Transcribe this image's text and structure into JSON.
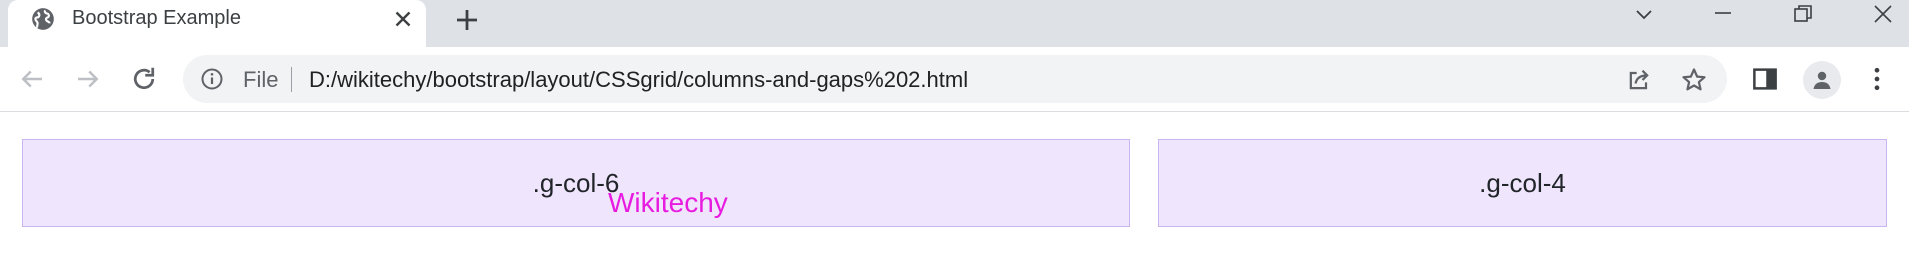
{
  "browser": {
    "tab": {
      "title": "Bootstrap Example",
      "favicon": "globe-icon"
    },
    "window_controls": [
      "tab-search-icon",
      "minimize-icon",
      "restore-icon",
      "close-window-icon"
    ],
    "nav": [
      "back-arrow-icon",
      "forward-arrow-icon",
      "reload-icon"
    ],
    "omnibox": {
      "scheme_label": "File",
      "url": "D:/wikitechy/bootstrap/layout/CSSgrid/columns-and-gaps%202.html"
    },
    "toolbar_icons": [
      "share-icon",
      "star-icon",
      "side-panel-icon",
      "profile-icon",
      "menu-icon"
    ]
  },
  "page": {
    "cells": [
      {
        "label": ".g-col-6"
      },
      {
        "label": ".g-col-4"
      }
    ],
    "overlay_text": "Wikitechy"
  },
  "colors": {
    "cell_bg": "#efe6fd",
    "cell_border": "#c8b5f2",
    "overlay_text": "#e81be0",
    "tabstrip_bg": "#dee1e6"
  }
}
